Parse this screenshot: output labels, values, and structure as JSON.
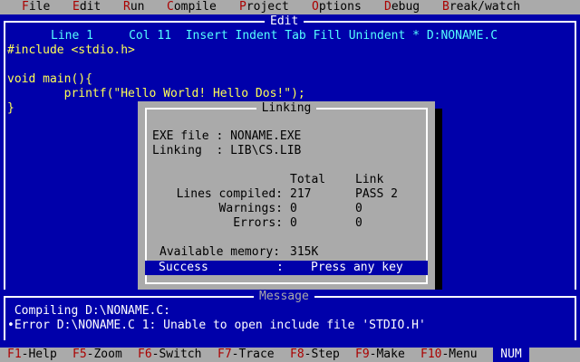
{
  "menu": [
    {
      "hot": "F",
      "rest": "ile"
    },
    {
      "hot": "E",
      "rest": "dit"
    },
    {
      "hot": "R",
      "rest": "un"
    },
    {
      "hot": "C",
      "rest": "ompile"
    },
    {
      "hot": "P",
      "rest": "roject"
    },
    {
      "hot": "O",
      "rest": "ptions"
    },
    {
      "hot": "D",
      "rest": "ebug"
    },
    {
      "hot": "B",
      "rest": "reak/watch"
    }
  ],
  "editor": {
    "title": "Edit",
    "status": "Line 1     Col 11  Insert Indent Tab Fill Unindent * D:NONAME.C",
    "code": [
      "#include <stdio.h>",
      "",
      "void main(){",
      "        printf(\"Hello World! Hello Dos!\");",
      "}"
    ]
  },
  "dialog": {
    "title": "Linking",
    "exe_label": "EXE file : NONAME.EXE",
    "linking_label": "Linking  : LIB\\CS.LIB",
    "col_total": "Total",
    "col_link": "Link",
    "rows": [
      {
        "label": "Lines compiled:",
        "total": "217",
        "link": "PASS 2"
      },
      {
        "label": "Warnings:",
        "total": "0",
        "link": "0"
      },
      {
        "label": "Errors:",
        "total": "0",
        "link": "0"
      }
    ],
    "memory_label": "Available memory:",
    "memory_value": "315K",
    "success_label": "Success",
    "success_sep": ":",
    "success_prompt": "Press any key"
  },
  "message": {
    "title": "Message",
    "lines": [
      " Compiling D:\\NONAME.C:",
      "•Error D:\\NONAME.C 1: Unable to open include file 'STDIO.H'"
    ]
  },
  "fnbar": [
    {
      "key": "F1",
      "label": "-Help"
    },
    {
      "key": "F5",
      "label": "-Zoom"
    },
    {
      "key": "F6",
      "label": "-Switch"
    },
    {
      "key": "F7",
      "label": "-Trace"
    },
    {
      "key": "F8",
      "label": "-Step"
    },
    {
      "key": "F9",
      "label": "-Make"
    },
    {
      "key": "F10",
      "label": "-Menu"
    }
  ],
  "num_indicator": "NUM",
  "colors": {
    "background": "#0000AA",
    "menu_bar": "#AAAAAA",
    "hotkey": "#AA0000",
    "code_text": "#FFFF55",
    "status_text": "#55FFFF"
  }
}
